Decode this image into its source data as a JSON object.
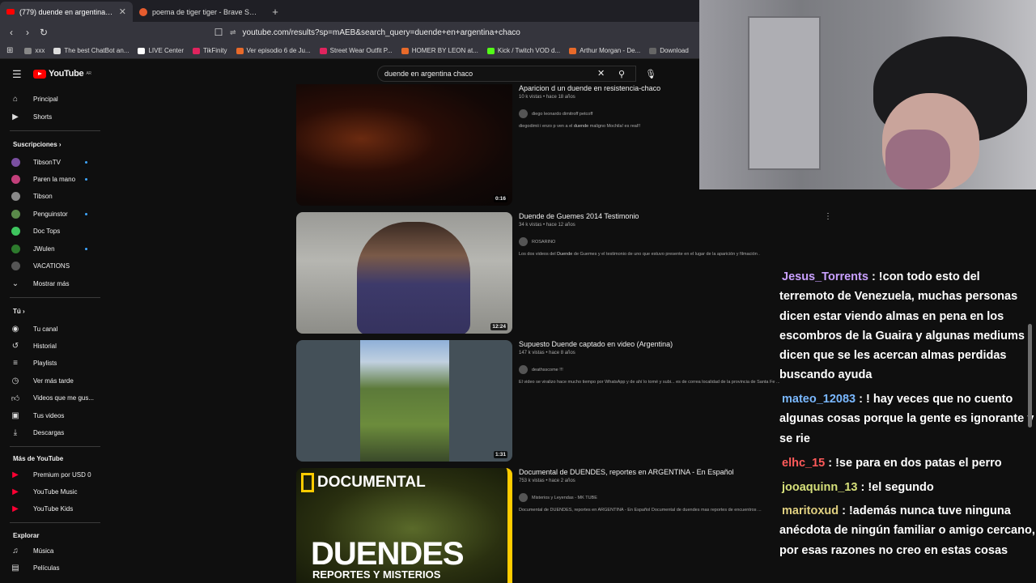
{
  "browser": {
    "tabs": [
      {
        "title": "(779) duende en argentina chac",
        "active": true,
        "icon": "youtube-favicon"
      },
      {
        "title": "poema de tiger tiger - Brave Search",
        "active": false,
        "icon": "brave-favicon"
      }
    ],
    "url": "youtube.com/results?sp=mAEB&search_query=duende+en+argentina+chaco",
    "bookmarks": [
      {
        "label": "xxx",
        "color": "#888888"
      },
      {
        "label": "The best ChatBot an...",
        "color": "#dddddd"
      },
      {
        "label": "LIVE Center",
        "color": "#ffffff"
      },
      {
        "label": "TikFinity",
        "color": "#e0245e"
      },
      {
        "label": "Ver episodio 6 de Ju...",
        "color": "#e86a2a"
      },
      {
        "label": "Street Wear Outfit P...",
        "color": "#e0245e"
      },
      {
        "label": "HOMER BY LEON at...",
        "color": "#e86a2a"
      },
      {
        "label": "Kick / Twitch VOD d...",
        "color": "#53fc18"
      },
      {
        "label": "Arthur Morgan - De...",
        "color": "#e86a2a"
      },
      {
        "label": "Download",
        "color": "#666666"
      }
    ]
  },
  "youtube": {
    "logo": "YouTube",
    "country": "AR",
    "search_value": "duende en argentina chaco",
    "sidebar": {
      "main": [
        {
          "label": "Principal",
          "icon": "home-icon"
        },
        {
          "label": "Shorts",
          "icon": "shorts-icon"
        }
      ],
      "subs_header": "Suscripciones",
      "subs": [
        {
          "label": "TibsonTV",
          "color": "#7a4fa0",
          "dot": true
        },
        {
          "label": "Paren la mano",
          "color": "#c23f7a",
          "dot": true
        },
        {
          "label": "Tibson",
          "color": "#8a8a8a",
          "dot": false
        },
        {
          "label": "Penguinstor",
          "color": "#5a8a4a",
          "dot": true
        },
        {
          "label": "Doc Tops",
          "color": "#3ec55e",
          "dot": false
        },
        {
          "label": "JWulen",
          "color": "#2d7a2d",
          "dot": true
        },
        {
          "label": "VACATIONS",
          "color": "#555555",
          "dot": false
        }
      ],
      "show_more": "Mostrar más",
      "you_header": "Tú",
      "you": [
        {
          "label": "Tu canal",
          "icon": "channel-icon"
        },
        {
          "label": "Historial",
          "icon": "history-icon"
        },
        {
          "label": "Playlists",
          "icon": "playlists-icon"
        },
        {
          "label": "Ver más tarde",
          "icon": "watch-later-icon"
        },
        {
          "label": "Videos que me gus...",
          "icon": "like-icon"
        },
        {
          "label": "Tus videos",
          "icon": "your-videos-icon"
        },
        {
          "label": "Descargas",
          "icon": "downloads-icon"
        }
      ],
      "more_header": "Más de YouTube",
      "more": [
        {
          "label": "Premium por USD 0",
          "color": "#ff0033"
        },
        {
          "label": "YouTube Music",
          "color": "#ff0033"
        },
        {
          "label": "YouTube Kids",
          "color": "#ff0033"
        }
      ],
      "explore_header": "Explorar",
      "explore": [
        {
          "label": "Música",
          "icon": "music-icon"
        },
        {
          "label": "Películas",
          "icon": "movies-icon"
        }
      ]
    },
    "results": [
      {
        "title": "Aparicion d un duende en resistencia-chaco",
        "meta": "10 k vistas • hace 18 años",
        "channel": "diego leonardo dimitroff petcoff",
        "desc_pre": "diegodimii i enzo p ven a el ",
        "desc_bold": "duende",
        "desc_post": " maligno Mochila! es real!!",
        "duration": "0:16"
      },
      {
        "title": "Duende de Guemes 2014 Testimonio",
        "meta": "34 k vistas • hace 12 años",
        "channel": "ROSARINO",
        "desc_pre": "Los dos videos del ",
        "desc_bold": "Duende",
        "desc_post": " de Guemes y el testimonio de uno que estuvo presente en el lugar de la aparición y filmación .",
        "duration": "12:24"
      },
      {
        "title": "Supuesto Duende captado en video (Argentina)",
        "meta": "147 k vistas • hace 8 años",
        "channel": "deathsscome !!!",
        "desc_pre": "El video se viralizo hace mucho tiempo por WhatsApp y de ahí lo tomé y subi... es de correa localidad de la provincia de Santa Fe ...",
        "desc_bold": "",
        "desc_post": "",
        "duration": "1:31"
      },
      {
        "title": "Documental de DUENDES, reportes en ARGENTINA - En Español",
        "meta": "753 k vistas • hace 2 años",
        "channel": "Misterios y Leyendas - MK TUBE",
        "desc_pre": "Documental de DUENDES, reportes en ARGENTINA - En Español Documental de duendes mas reportes de encuentros ...",
        "desc_bold": "",
        "desc_post": "",
        "duration": "",
        "thumb_top": "DOCUMENTAL",
        "thumb_big": "DUENDES",
        "thumb_sub": "REPORTES Y MISTERIOS"
      }
    ]
  },
  "chat": [
    {
      "user": "Jesus_Torrents",
      "color": "#c9a0ff",
      "text": ": !con todo esto del terremoto de Venezuela, muchas personas dicen estar viendo almas en pena en los escombros de la Guaira y algunas mediums dicen que se les acercan almas perdidas buscando ayuda"
    },
    {
      "user": "mateo_12083",
      "color": "#7ab8ff",
      "text": ": ! hay veces que no cuento algunas cosas porque la gente es ignorante y se rie"
    },
    {
      "user": "elhc_15",
      "color": "#ff5a5a",
      "text": ": !se para en dos patas el perro"
    },
    {
      "user": "jooaquinn_13",
      "color": "#d6e07a",
      "text": ": !el segundo"
    },
    {
      "user": "maritoxud",
      "color": "#e0d080",
      "text": ": !además nunca tuve ninguna anécdota de ningún familiar o amigo cercano, por esas razones no creo en estas cosas"
    }
  ]
}
